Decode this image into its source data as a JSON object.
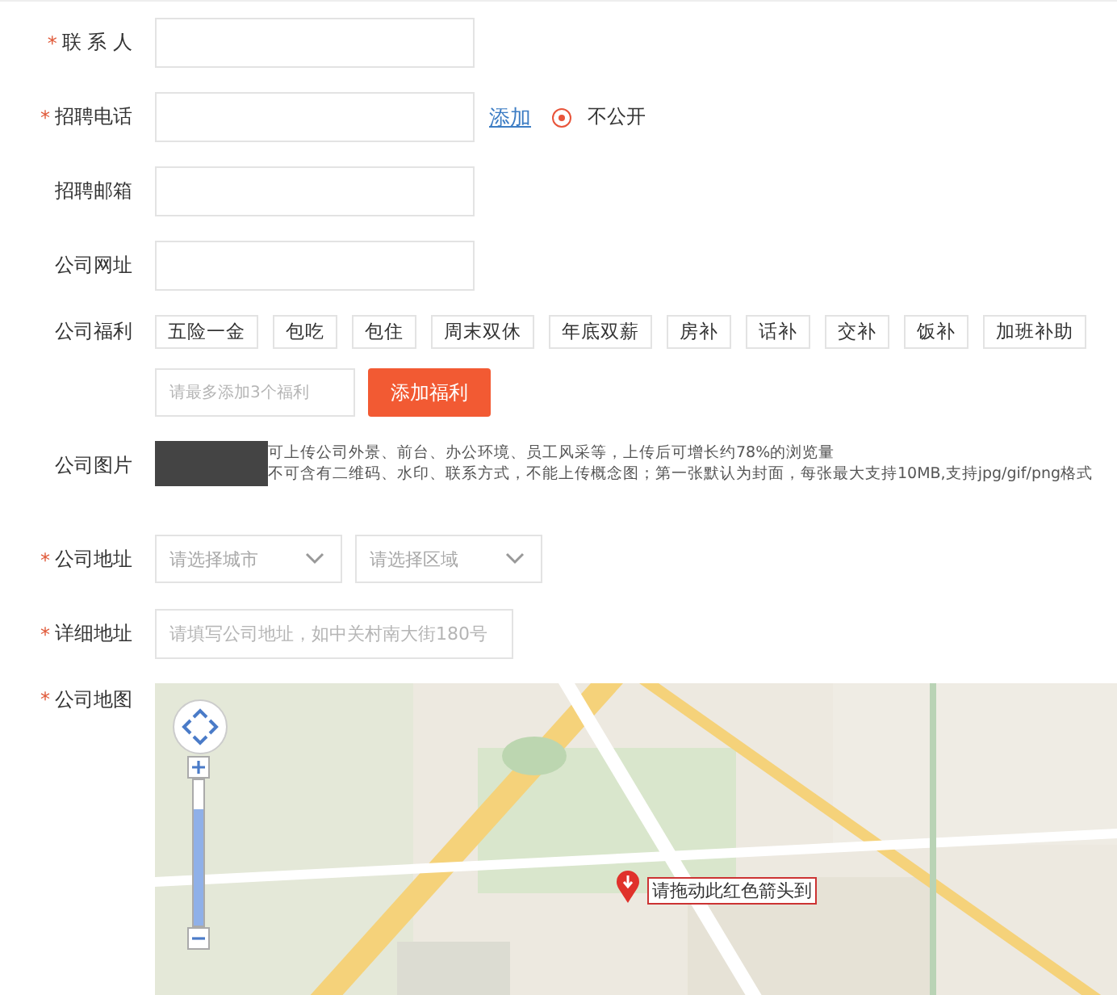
{
  "fields": [
    {
      "kind": "text",
      "label": "联 系 人",
      "mark": "*"
    },
    {
      "kind": "phone",
      "label": "招聘电话",
      "mark": "*",
      "link": "添加",
      "radio": {
        "label": "不公开",
        "checked": true
      }
    },
    {
      "kind": "text",
      "label": "招聘邮箱"
    },
    {
      "kind": "text",
      "label": "公司网址"
    },
    {
      "kind": "benefits",
      "label": "公司福利",
      "tags": [
        "五险一金",
        "包吃",
        "包住",
        "周末双休",
        "年底双薪",
        "房补",
        "话补",
        "交补",
        "饭补",
        "加班补助"
      ],
      "placeholder": "请最多添加3个福利",
      "button": "添加福利"
    },
    {
      "label": "公司图片",
      "notes": [
        "可上传公司外景、前台、办公环境、员工风采等，上传后可增长约78%的浏览量",
        "不可含有二维码、水印、联系方式，不能上传概念图；第一张默认为封面，每张最大支持10MB,支持jpg/gif/png格式"
      ]
    },
    {
      "kind": "selects",
      "label": "公司地址",
      "mark": "*",
      "selects": [
        {
          "placeholder": "请选择城市"
        },
        {
          "placeholder": "请选择区域"
        }
      ]
    },
    {
      "kind": "address",
      "label": "详细地址",
      "mark": "*",
      "placeholder": "请填写公司地址，如中关村南大街180号"
    },
    {
      "kind": "map",
      "label": "公司地图",
      "mark": "*",
      "map": {
        "zoom": {
          "level": 0.8
        },
        "callout": "请拖动此红色箭头到"
      }
    }
  ]
}
